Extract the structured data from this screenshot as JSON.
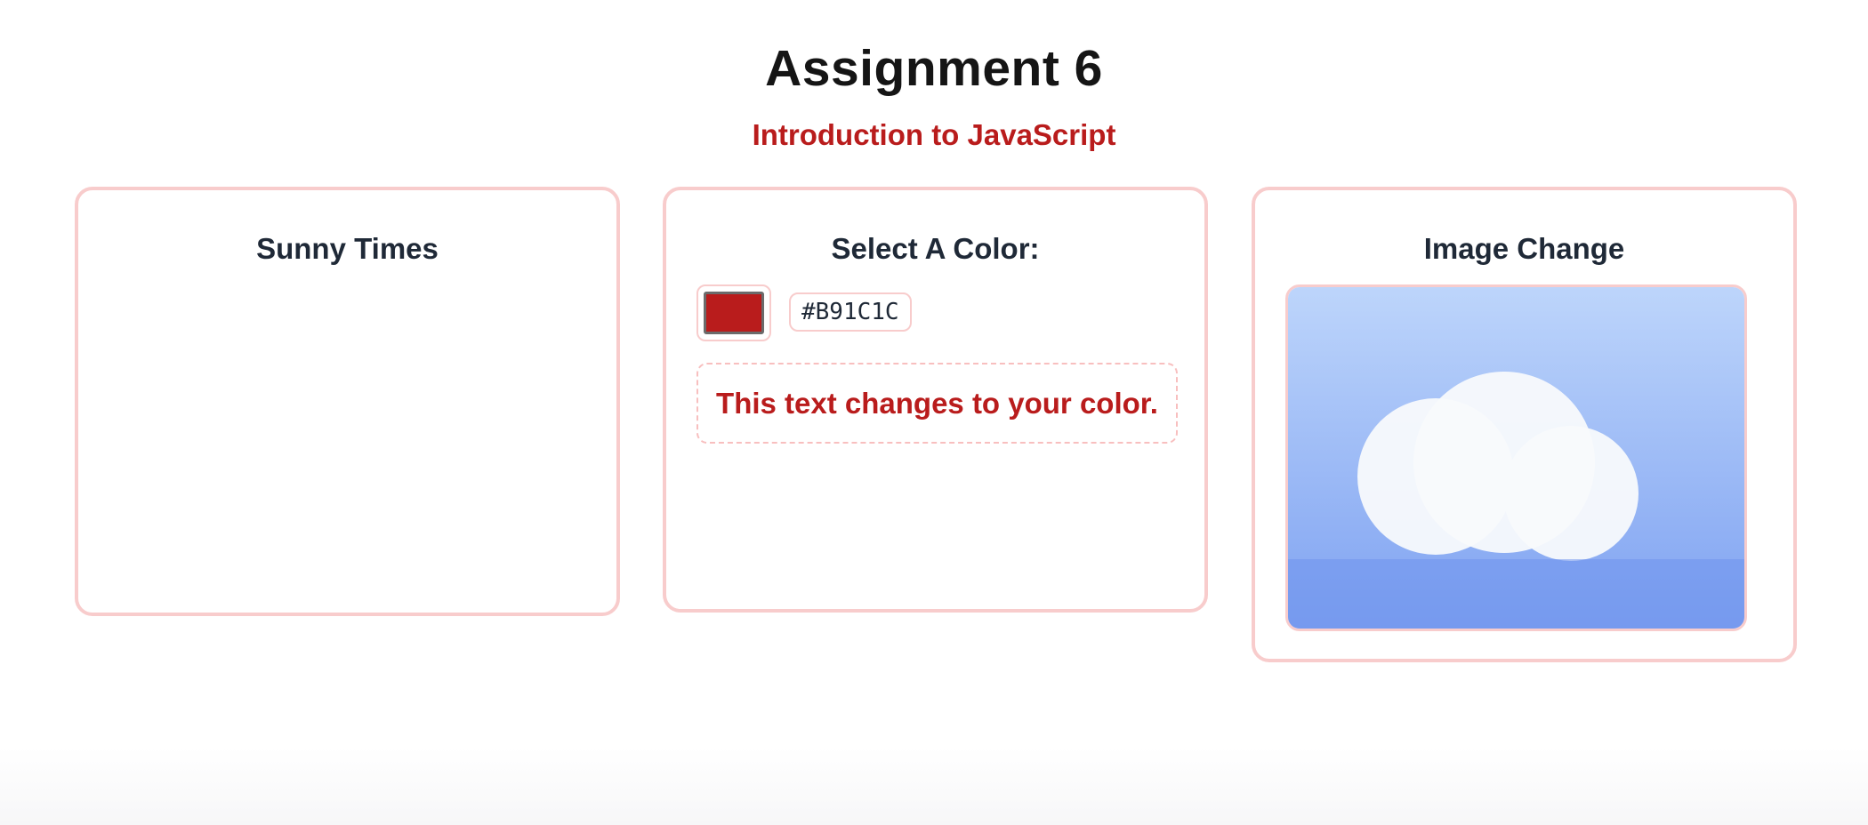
{
  "header": {
    "title": "Assignment 6",
    "subtitle": "Introduction to JavaScript"
  },
  "cards": {
    "sunny": {
      "title": "Sunny Times"
    },
    "color": {
      "title": "Select A Color:",
      "selected_color": "#B91C1C",
      "hex_label": "#B91C1C",
      "sample_text": "This text changes to your color."
    },
    "image": {
      "title": "Image Change",
      "image_icon": "cloud-icon"
    }
  },
  "colors": {
    "accent": "#b91c1c",
    "card_border": "#f8cccc",
    "sky_top": "#bdd5fb",
    "sky_bottom": "#7fa2f1",
    "cloud": "#f8fafc"
  }
}
